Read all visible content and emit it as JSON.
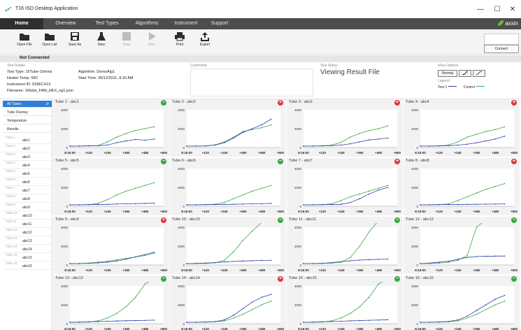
{
  "app": {
    "title": "T16 ISO Desktop Application",
    "brand": "axxin"
  },
  "window_controls": {
    "minimize": "—",
    "maximize": "☐",
    "close": "✕"
  },
  "menu": [
    {
      "label": "Home",
      "active": true
    },
    {
      "label": "Overview",
      "active": false
    },
    {
      "label": "Test Types",
      "active": false
    },
    {
      "label": "Algorithms",
      "active": false
    },
    {
      "label": "Instrument",
      "active": false
    },
    {
      "label": "Support",
      "active": false
    }
  ],
  "toolbar": {
    "open_file": "Open File",
    "open_list": "Open List",
    "save_as": "Save As",
    "new": "New",
    "stop": "Stop",
    "run": "Run",
    "print": "Print",
    "export": "Export",
    "connect": "Connect"
  },
  "connection_status": "Not Connected",
  "test_details": {
    "heading": "Test Details",
    "test_type": "Test Type: 16Tube-10mins",
    "heater_temp": "Heater Temp: 56C",
    "instrument_id": "Instrument ID: 618EC413",
    "filename": "Filename: 16tube_FAM_HEX_eg1.json",
    "algorithm": "Algorithm: DemoAlg1",
    "start_time": "Start Time: 28/12/2011, 8:16 AM"
  },
  "comments": {
    "heading": "Comments"
  },
  "test_status": {
    "heading": "Test Status",
    "value": "Viewing Result File"
  },
  "view_options": {
    "heading": "View Options",
    "normal": "Normal",
    "legend_heading": "Legend",
    "legend_test": "Test 1",
    "legend_control": "Control",
    "test_color": "#3340b0",
    "control_color": "#3aa845"
  },
  "sidebar": {
    "all_tubes": "All Tubes",
    "chevron": ">",
    "items": [
      "Tube Overlay",
      "Temperature",
      "Results"
    ],
    "tubes": [
      {
        "t": "Tube 1",
        "n": "abc1"
      },
      {
        "t": "Tube 2",
        "n": "abc2"
      },
      {
        "t": "Tube 3",
        "n": "abc3"
      },
      {
        "t": "Tube 4",
        "n": "abc4"
      },
      {
        "t": "Tube 5",
        "n": "abc5"
      },
      {
        "t": "Tube 6",
        "n": "abc6"
      },
      {
        "t": "Tube 7",
        "n": "abc7"
      },
      {
        "t": "Tube 8",
        "n": "abc8"
      },
      {
        "t": "Tube 9",
        "n": "abc9"
      },
      {
        "t": "Tube 10",
        "n": "abc10"
      },
      {
        "t": "Tube 11",
        "n": "abc11"
      },
      {
        "t": "Tube 12",
        "n": "abc12"
      },
      {
        "t": "Tube 13",
        "n": "abc13"
      },
      {
        "t": "Tube 14",
        "n": "abc14"
      },
      {
        "t": "Tube 15",
        "n": "abc15"
      },
      {
        "t": "Tube 16",
        "n": "abc16"
      }
    ]
  },
  "status_colors": {
    "negative": "#3aa845",
    "positive": "#d93a3a"
  },
  "chart_data": {
    "type": "line",
    "x_ticks": [
      "8:16:00",
      "+120",
      "+240",
      "+360",
      "+480",
      "+600"
    ],
    "x": [
      0,
      60,
      120,
      180,
      240,
      300,
      360,
      420,
      480,
      540
    ],
    "ylim": [
      0,
      4000
    ],
    "y_ticks": [
      "0",
      "2000",
      "4000"
    ],
    "panels": [
      {
        "title": "Tube 1 - abc1",
        "status": "negative",
        "test": [
          150,
          160,
          180,
          200,
          260,
          520,
          700,
          850,
          780,
          900
        ],
        "control": [
          150,
          160,
          170,
          200,
          600,
          1100,
          1500,
          1800,
          2000,
          2200
        ]
      },
      {
        "title": "Tube 2 - abc2",
        "status": "positive",
        "test": [
          150,
          160,
          170,
          250,
          500,
          1000,
          1600,
          2000,
          2400,
          3000
        ],
        "control": [
          150,
          160,
          170,
          280,
          600,
          1100,
          1700,
          1900,
          2100,
          2400
        ]
      },
      {
        "title": "Tube 3 - abc3",
        "status": "positive",
        "test": [
          150,
          160,
          170,
          200,
          260,
          400,
          600,
          800,
          900,
          1000
        ],
        "control": [
          150,
          160,
          170,
          250,
          550,
          1100,
          1500,
          1800,
          2000,
          2300
        ]
      },
      {
        "title": "Tube 4 - abc4",
        "status": "positive",
        "test": [
          150,
          160,
          170,
          200,
          250,
          350,
          500,
          700,
          900,
          1200
        ],
        "control": [
          150,
          160,
          170,
          260,
          600,
          1100,
          1400,
          1700,
          1900,
          2200
        ]
      },
      {
        "title": "Tube 5 - abc5",
        "status": "negative",
        "test": [
          150,
          160,
          170,
          180,
          200,
          240,
          260,
          280,
          300,
          320
        ],
        "control": [
          150,
          160,
          170,
          300,
          700,
          1200,
          1600,
          1900,
          2200,
          2500
        ]
      },
      {
        "title": "Tube 6 - abc6",
        "status": "negative",
        "test": [
          150,
          160,
          170,
          180,
          190,
          210,
          230,
          250,
          270,
          300
        ],
        "control": [
          150,
          160,
          170,
          220,
          400,
          800,
          1200,
          1600,
          1900,
          2200
        ]
      },
      {
        "title": "Tube 7 - abc7",
        "status": "positive",
        "test": [
          150,
          160,
          170,
          180,
          200,
          400,
          800,
          1300,
          1700,
          2000
        ],
        "control": [
          150,
          160,
          170,
          250,
          600,
          1000,
          1300,
          1600,
          1900,
          2200
        ]
      },
      {
        "title": "Tube 8 - abc8",
        "status": "positive",
        "test": [
          150,
          160,
          170,
          180,
          190,
          200,
          210,
          220,
          230,
          250
        ],
        "control": [
          150,
          160,
          170,
          250,
          600,
          1000,
          1400,
          1800,
          2100,
          2400
        ]
      },
      {
        "title": "Tube 9 - abc9",
        "status": "positive",
        "test": [
          150,
          160,
          180,
          220,
          300,
          420,
          620,
          860,
          1100,
          1350
        ],
        "control": [
          150,
          160,
          200,
          300,
          400,
          550,
          700,
          850,
          1000,
          1250
        ]
      },
      {
        "title": "Tube 10 - abc10",
        "status": "negative",
        "test": [
          150,
          170,
          200,
          250,
          320,
          380,
          420,
          450,
          480,
          500
        ],
        "control": [
          150,
          160,
          170,
          220,
          500,
          1400,
          2600,
          3600,
          4500,
          4900
        ]
      },
      {
        "title": "Tube 11 - abc11",
        "status": "negative",
        "test": [
          150,
          160,
          180,
          250,
          350,
          450,
          520,
          560,
          600,
          620
        ],
        "control": [
          150,
          160,
          170,
          200,
          300,
          800,
          2000,
          3500,
          4700,
          4900
        ]
      },
      {
        "title": "Tube 12 - abc12",
        "status": "negative",
        "test": [
          150,
          200,
          300,
          400,
          600,
          800,
          900,
          920,
          940,
          950
        ],
        "control": [
          150,
          160,
          200,
          300,
          500,
          1000,
          4000,
          4900,
          4900,
          4900
        ]
      },
      {
        "title": "Tube 13 - abc13",
        "status": "negative",
        "test": [
          150,
          170,
          200,
          230,
          260,
          290,
          310,
          330,
          350,
          380
        ],
        "control": [
          150,
          160,
          180,
          300,
          600,
          1100,
          1800,
          2800,
          4200,
          4900
        ]
      },
      {
        "title": "Tube 14 - abc14",
        "status": "positive",
        "test": [
          150,
          160,
          180,
          220,
          400,
          900,
          1600,
          2300,
          2800,
          3100
        ],
        "control": [
          150,
          160,
          170,
          200,
          300,
          600,
          1000,
          1500,
          2000,
          2400
        ]
      },
      {
        "title": "Tube 15 - abc15",
        "status": "negative",
        "test": [
          150,
          170,
          200,
          230,
          260,
          300,
          330,
          360,
          390,
          420
        ],
        "control": [
          150,
          160,
          180,
          300,
          600,
          1100,
          1800,
          2800,
          4200,
          4900
        ]
      },
      {
        "title": "Tube 16 - abc16",
        "status": "negative",
        "test": [
          150,
          160,
          180,
          240,
          400,
          800,
          1400,
          2000,
          2600,
          3000
        ],
        "control": [
          150,
          160,
          170,
          200,
          300,
          600,
          1000,
          1500,
          2000,
          2400
        ]
      }
    ]
  }
}
